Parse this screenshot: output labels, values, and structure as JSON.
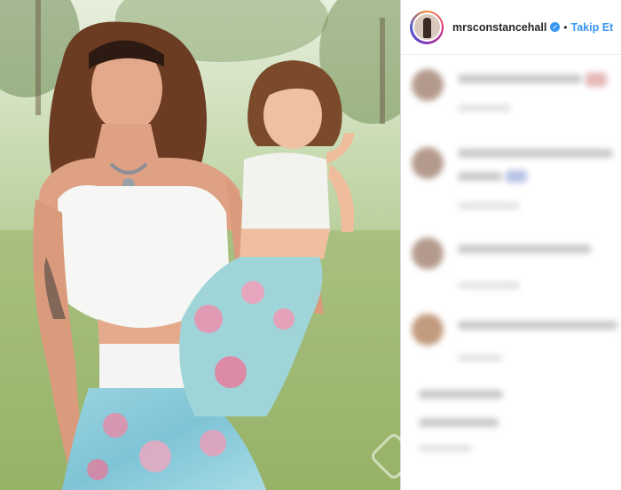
{
  "post": {
    "photo_icon": "photo-of-mother-and-daughter",
    "author": {
      "username": "mrsconstancehall",
      "verified_icon": "verified-badge-icon",
      "separator": "•",
      "follow_label": "Takip Et"
    },
    "comments_blurred": true
  },
  "colors": {
    "follow": "#3897f0",
    "verified": "#3897f0",
    "text": "#262626"
  }
}
